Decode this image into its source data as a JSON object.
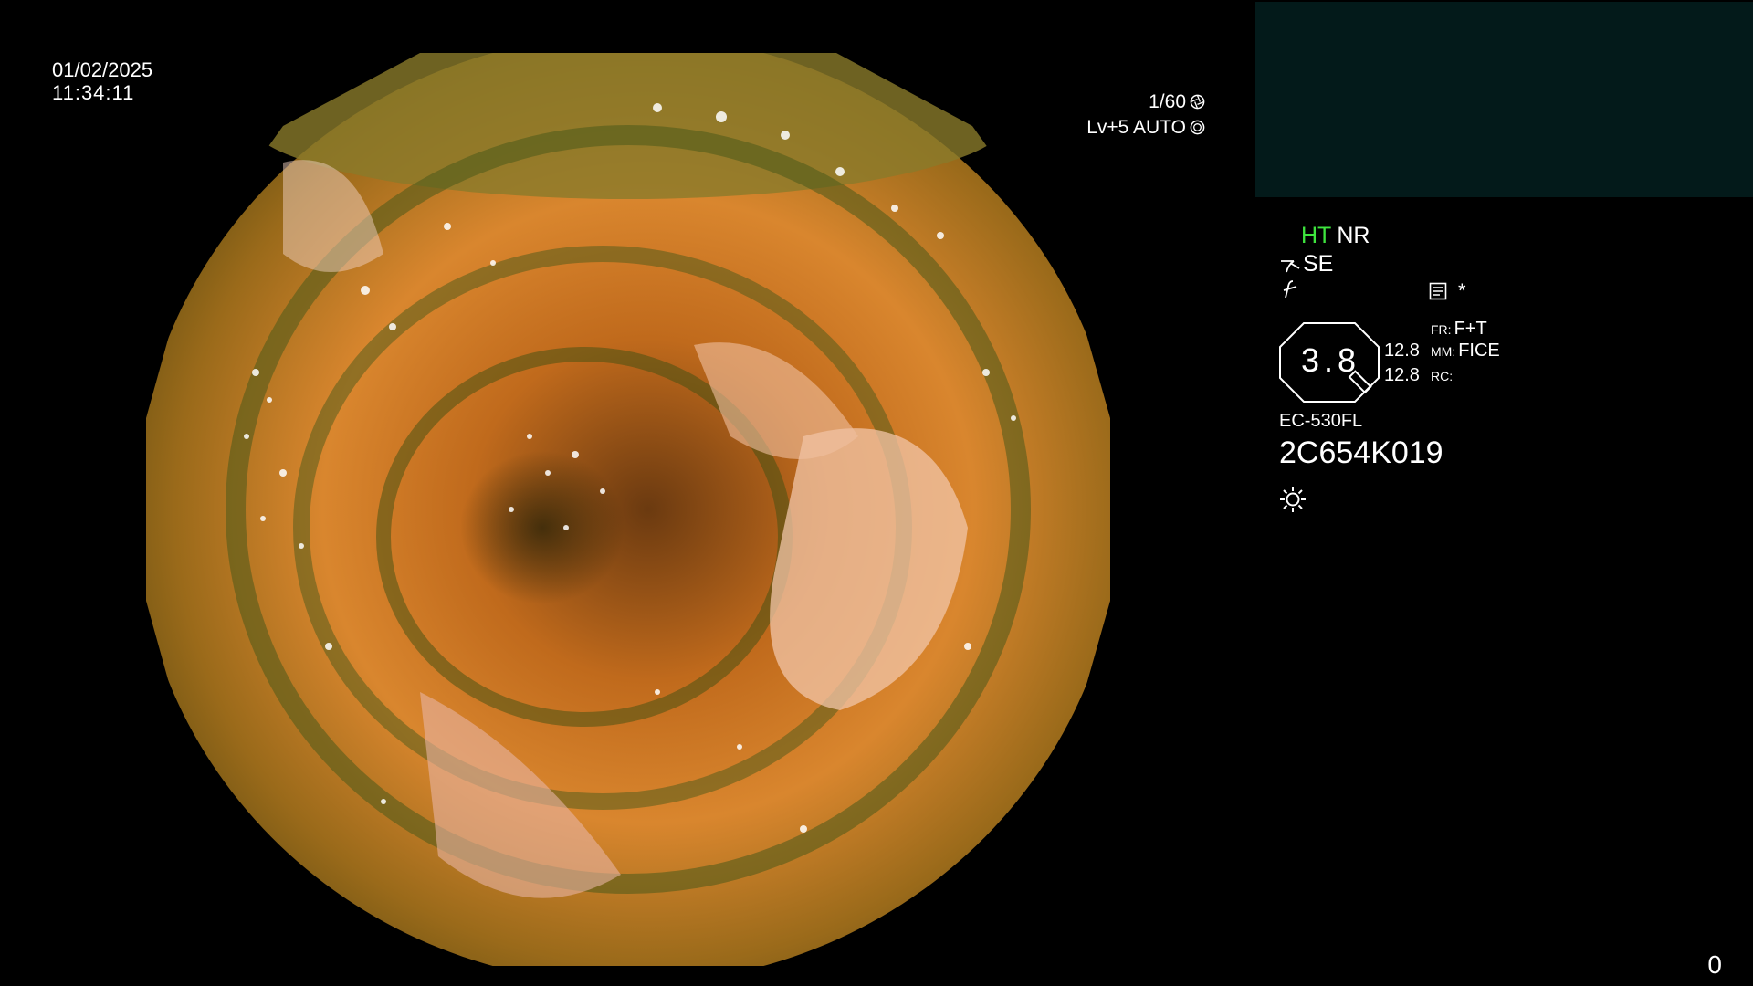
{
  "header": {
    "date": "01/02/2025",
    "time": "11:34:11"
  },
  "exposure": {
    "shutter": "1/60",
    "level": "Lv+5 AUTO"
  },
  "info_panel": {
    "ht_label": "HT",
    "nr_label": "NR",
    "se_label": "SE",
    "zoom_value": "3.8",
    "value_a": "12.8",
    "value_b": "12.8",
    "fr_label": "FR:",
    "fr_value": "F+T",
    "mm_label": "MM:",
    "mm_value": "FICE",
    "rc_label": "RC:",
    "rc_value": "",
    "star": "*",
    "scope_model": "EC-530FL",
    "scope_serial": "2C654K019"
  },
  "footer": {
    "counter": "0"
  },
  "colors": {
    "ht_green": "#3ee43e",
    "sub_screen": "#031a1a",
    "background": "#000000"
  },
  "icons": [
    "shutter-icon",
    "iris-icon",
    "structure-enhance-icon",
    "f-curve-icon",
    "memo-icon",
    "light-icon"
  ]
}
